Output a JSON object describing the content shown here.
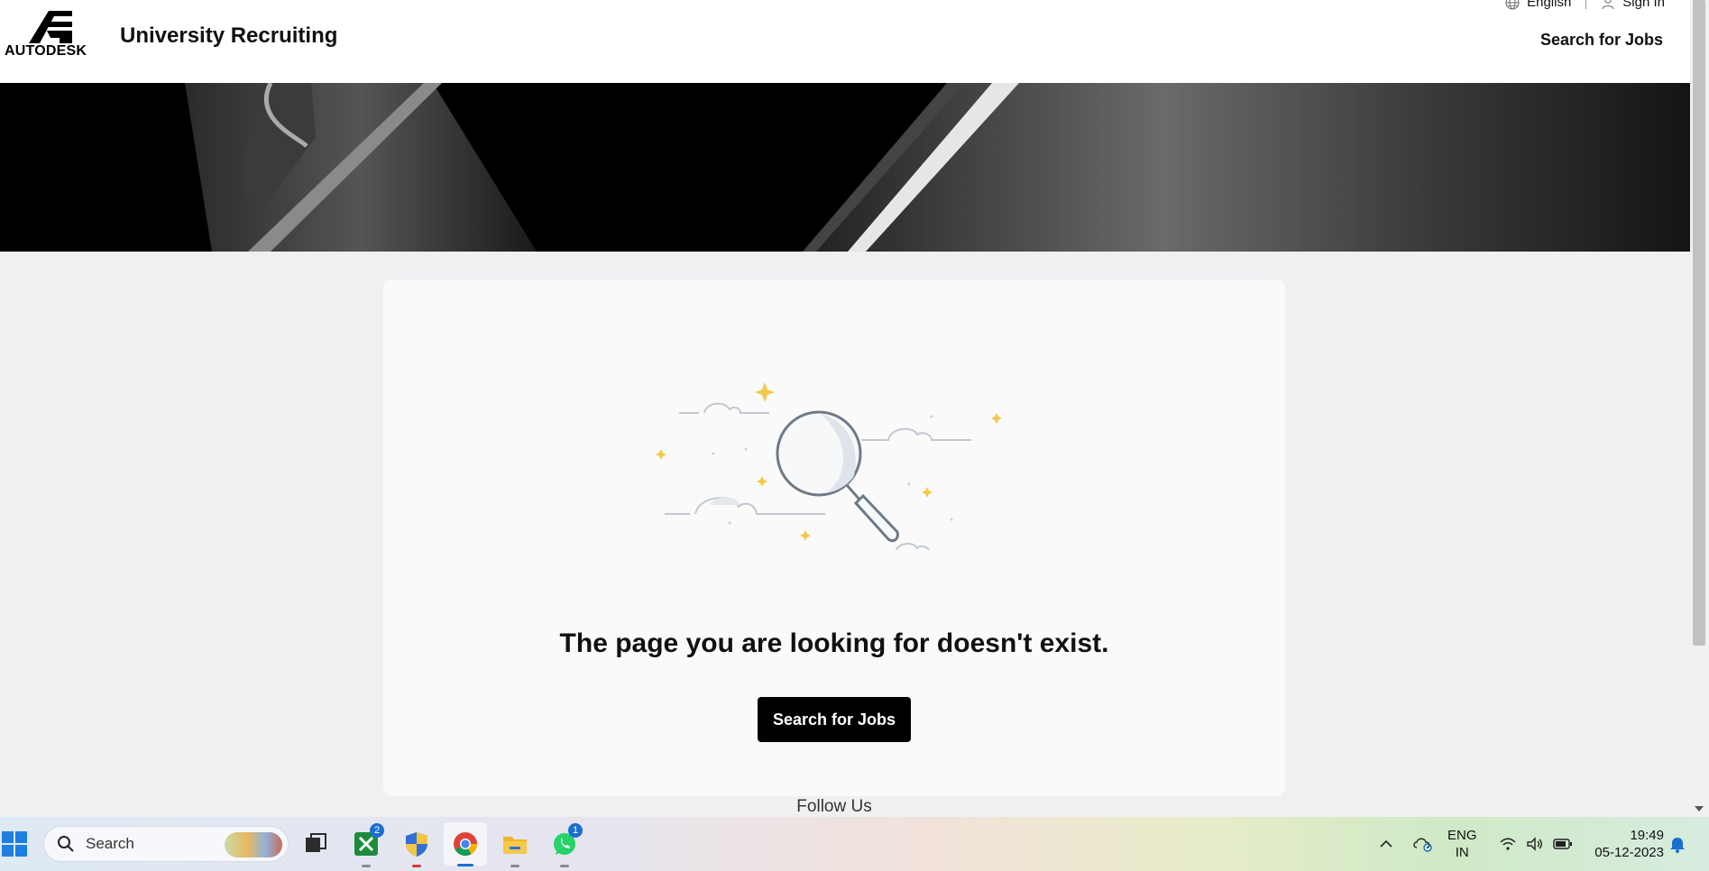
{
  "header": {
    "logo_text": "AUTODESK",
    "site_title": "University Recruiting",
    "language_label": "English",
    "sign_in_label": "Sign In",
    "nav_search_label": "Search for Jobs"
  },
  "main": {
    "error_message": "The page you are looking for doesn't exist.",
    "cta_label": "Search for Jobs",
    "illustration_icon": "magnifier-clouds-illustration"
  },
  "footer": {
    "follow_label": "Follow Us"
  },
  "taskbar": {
    "search_placeholder": "Search",
    "apps": [
      {
        "name": "task-view",
        "badge": ""
      },
      {
        "name": "xbox-app",
        "badge": "2"
      },
      {
        "name": "windows-security",
        "badge": ""
      },
      {
        "name": "chrome",
        "badge": ""
      },
      {
        "name": "file-explorer",
        "badge": ""
      },
      {
        "name": "whatsapp",
        "badge": "1"
      }
    ],
    "lang_line1": "ENG",
    "lang_line2": "IN",
    "time": "19:49",
    "date": "05-12-2023"
  },
  "colors": {
    "accent": "#000000",
    "page_bg": "#eef0f2",
    "card_bg": "#fafafa",
    "sparkle": "#f2c94c",
    "taskbar_badge": "#1a6fd1"
  }
}
